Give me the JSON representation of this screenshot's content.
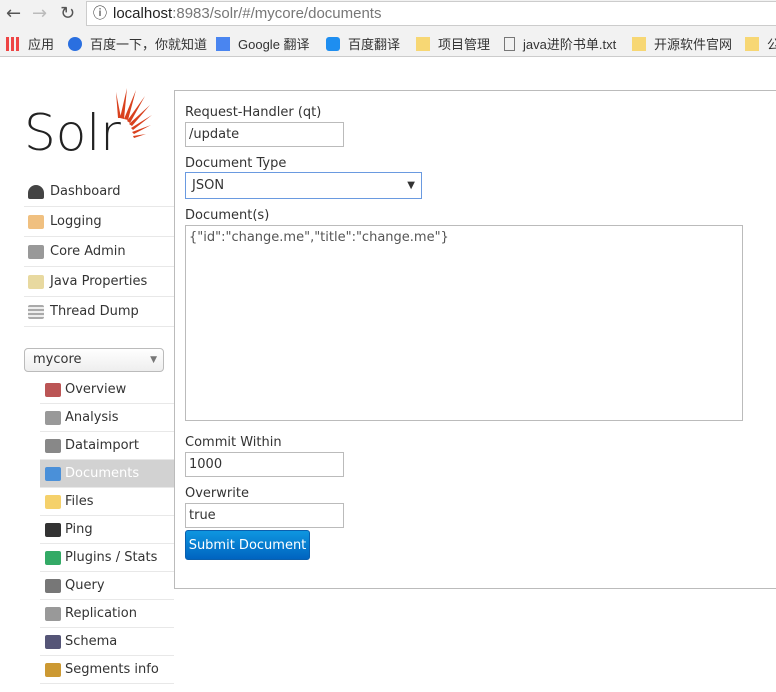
{
  "browser": {
    "url_host": "localhost",
    "url_rest": ":8983/solr/#/mycore/documents",
    "bookmarks": [
      "应用",
      "百度一下，你就知道",
      "Google 翻译",
      "百度翻译",
      "项目管理",
      "java进阶书单.txt",
      "开源软件官网",
      "公"
    ]
  },
  "logo": {
    "text": "Solr"
  },
  "nav": [
    "Dashboard",
    "Logging",
    "Core Admin",
    "Java Properties",
    "Thread Dump"
  ],
  "core_selector": "mycore",
  "core_nav": [
    "Overview",
    "Analysis",
    "Dataimport",
    "Documents",
    "Files",
    "Ping",
    "Plugins / Stats",
    "Query",
    "Replication",
    "Schema",
    "Segments info"
  ],
  "form": {
    "handler_label": "Request-Handler (qt)",
    "handler_value": "/update",
    "doctype_label": "Document Type",
    "doctype_value": "JSON",
    "docs_label": "Document(s)",
    "docs_value": "{\"id\":\"change.me\",\"title\":\"change.me\"}",
    "commit_label": "Commit Within",
    "commit_value": "1000",
    "overwrite_label": "Overwrite",
    "overwrite_value": "true",
    "submit": "Submit Document"
  },
  "colors": {
    "accent": "#0a7fd6",
    "logo_red": "#d9411e"
  }
}
